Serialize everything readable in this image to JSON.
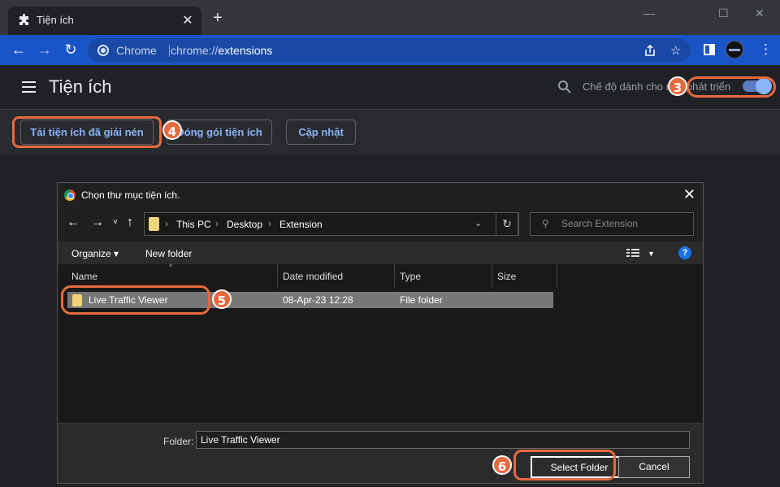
{
  "tab": {
    "title": "Tiện ích",
    "close_glyph": "✕",
    "new_tab_glyph": "+"
  },
  "window_controls": {
    "minimize": "—",
    "maximize": "☐",
    "close": "✕"
  },
  "toolbar": {
    "back": "←",
    "forward": "→",
    "reload": "↻",
    "chip_label": "Chrome",
    "url_prefix": "chrome://",
    "url_path": "extensions",
    "menu_glyph": "⋮"
  },
  "extensions_page": {
    "title": "Tiện ích",
    "dev_mode_label": "Chế độ dành cho nhà phát triển",
    "dev_mode_on": true,
    "buttons": {
      "load_unpacked": "Tải tiện ích đã giải nén",
      "pack": "Đóng gói tiện ích",
      "update": "Cập nhật"
    }
  },
  "callouts": [
    "3",
    "4",
    "5",
    "6"
  ],
  "dialog": {
    "title": "Chọn thư mục tiện ích.",
    "close_glyph": "✕",
    "breadcrumb": [
      "This PC",
      "Desktop",
      "Extension"
    ],
    "search_placeholder": "Search Extension",
    "organize": "Organize ▾",
    "new_folder": "New folder",
    "help": "?",
    "columns": {
      "name": "Name",
      "date": "Date modified",
      "type": "Type",
      "size": "Size"
    },
    "rows": [
      {
        "name": "Live Traffic Viewer",
        "date": "08-Apr-23 12:28",
        "type": "File folder",
        "size": ""
      }
    ],
    "folder_label": "Folder:",
    "folder_value": "Live Traffic Viewer",
    "select_button": "Select Folder",
    "cancel_button": "Cancel"
  },
  "colors": {
    "accent": "#e7693e",
    "toolbar": "#1a55c8",
    "link": "#8ab4f8"
  }
}
